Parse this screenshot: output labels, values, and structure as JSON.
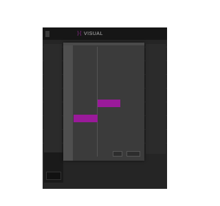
{
  "topbar": {
    "tabs": [
      "",
      ""
    ],
    "brand": "VISUAL"
  },
  "dialog": {
    "side_title": "",
    "rows": [
      {
        "label": "",
        "value": ""
      },
      {
        "label": "",
        "value": ""
      },
      {
        "label": "",
        "value": ""
      },
      {
        "label": "",
        "value": ""
      },
      {
        "label": "",
        "value": ""
      },
      {
        "label": "",
        "value": ""
      },
      {
        "label": "",
        "value": ""
      },
      {
        "label": "",
        "value": ""
      },
      {
        "label": "",
        "value": ""
      },
      {
        "label": "",
        "value": ""
      },
      {
        "label": "",
        "value": ""
      },
      {
        "label": "",
        "value": ""
      },
      {
        "label": "",
        "value": ""
      },
      {
        "label": "",
        "value": ""
      },
      {
        "label": "",
        "value": ""
      }
    ],
    "ok_label": "",
    "cancel_label": ""
  },
  "bottom_panel": {
    "items": [
      "",
      ""
    ]
  },
  "colors": {
    "accent": "#9a1a9a",
    "background": "#252525",
    "dialog": "#3b3b3b"
  }
}
